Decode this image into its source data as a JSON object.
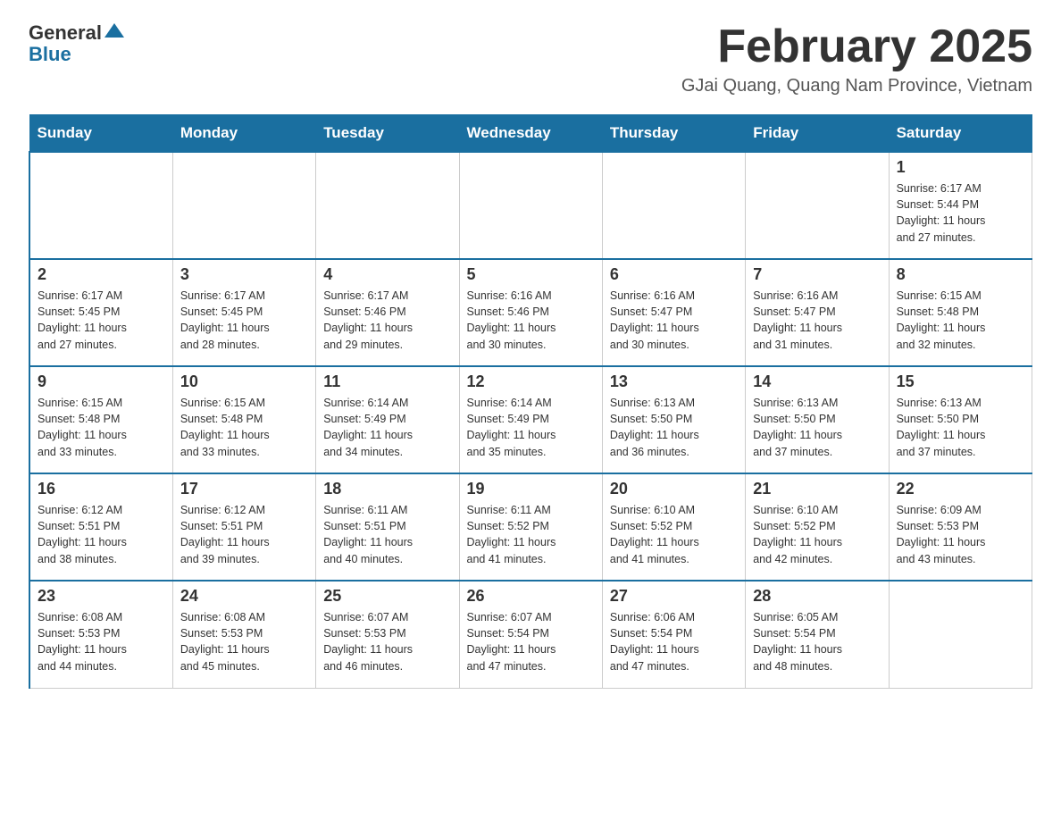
{
  "header": {
    "logo_general": "General",
    "logo_blue": "Blue",
    "title": "February 2025",
    "subtitle": "GJai Quang, Quang Nam Province, Vietnam"
  },
  "days_of_week": [
    "Sunday",
    "Monday",
    "Tuesday",
    "Wednesday",
    "Thursday",
    "Friday",
    "Saturday"
  ],
  "weeks": [
    [
      {
        "day": "",
        "info": ""
      },
      {
        "day": "",
        "info": ""
      },
      {
        "day": "",
        "info": ""
      },
      {
        "day": "",
        "info": ""
      },
      {
        "day": "",
        "info": ""
      },
      {
        "day": "",
        "info": ""
      },
      {
        "day": "1",
        "info": "Sunrise: 6:17 AM\nSunset: 5:44 PM\nDaylight: 11 hours\nand 27 minutes."
      }
    ],
    [
      {
        "day": "2",
        "info": "Sunrise: 6:17 AM\nSunset: 5:45 PM\nDaylight: 11 hours\nand 27 minutes."
      },
      {
        "day": "3",
        "info": "Sunrise: 6:17 AM\nSunset: 5:45 PM\nDaylight: 11 hours\nand 28 minutes."
      },
      {
        "day": "4",
        "info": "Sunrise: 6:17 AM\nSunset: 5:46 PM\nDaylight: 11 hours\nand 29 minutes."
      },
      {
        "day": "5",
        "info": "Sunrise: 6:16 AM\nSunset: 5:46 PM\nDaylight: 11 hours\nand 30 minutes."
      },
      {
        "day": "6",
        "info": "Sunrise: 6:16 AM\nSunset: 5:47 PM\nDaylight: 11 hours\nand 30 minutes."
      },
      {
        "day": "7",
        "info": "Sunrise: 6:16 AM\nSunset: 5:47 PM\nDaylight: 11 hours\nand 31 minutes."
      },
      {
        "day": "8",
        "info": "Sunrise: 6:15 AM\nSunset: 5:48 PM\nDaylight: 11 hours\nand 32 minutes."
      }
    ],
    [
      {
        "day": "9",
        "info": "Sunrise: 6:15 AM\nSunset: 5:48 PM\nDaylight: 11 hours\nand 33 minutes."
      },
      {
        "day": "10",
        "info": "Sunrise: 6:15 AM\nSunset: 5:48 PM\nDaylight: 11 hours\nand 33 minutes."
      },
      {
        "day": "11",
        "info": "Sunrise: 6:14 AM\nSunset: 5:49 PM\nDaylight: 11 hours\nand 34 minutes."
      },
      {
        "day": "12",
        "info": "Sunrise: 6:14 AM\nSunset: 5:49 PM\nDaylight: 11 hours\nand 35 minutes."
      },
      {
        "day": "13",
        "info": "Sunrise: 6:13 AM\nSunset: 5:50 PM\nDaylight: 11 hours\nand 36 minutes."
      },
      {
        "day": "14",
        "info": "Sunrise: 6:13 AM\nSunset: 5:50 PM\nDaylight: 11 hours\nand 37 minutes."
      },
      {
        "day": "15",
        "info": "Sunrise: 6:13 AM\nSunset: 5:50 PM\nDaylight: 11 hours\nand 37 minutes."
      }
    ],
    [
      {
        "day": "16",
        "info": "Sunrise: 6:12 AM\nSunset: 5:51 PM\nDaylight: 11 hours\nand 38 minutes."
      },
      {
        "day": "17",
        "info": "Sunrise: 6:12 AM\nSunset: 5:51 PM\nDaylight: 11 hours\nand 39 minutes."
      },
      {
        "day": "18",
        "info": "Sunrise: 6:11 AM\nSunset: 5:51 PM\nDaylight: 11 hours\nand 40 minutes."
      },
      {
        "day": "19",
        "info": "Sunrise: 6:11 AM\nSunset: 5:52 PM\nDaylight: 11 hours\nand 41 minutes."
      },
      {
        "day": "20",
        "info": "Sunrise: 6:10 AM\nSunset: 5:52 PM\nDaylight: 11 hours\nand 41 minutes."
      },
      {
        "day": "21",
        "info": "Sunrise: 6:10 AM\nSunset: 5:52 PM\nDaylight: 11 hours\nand 42 minutes."
      },
      {
        "day": "22",
        "info": "Sunrise: 6:09 AM\nSunset: 5:53 PM\nDaylight: 11 hours\nand 43 minutes."
      }
    ],
    [
      {
        "day": "23",
        "info": "Sunrise: 6:08 AM\nSunset: 5:53 PM\nDaylight: 11 hours\nand 44 minutes."
      },
      {
        "day": "24",
        "info": "Sunrise: 6:08 AM\nSunset: 5:53 PM\nDaylight: 11 hours\nand 45 minutes."
      },
      {
        "day": "25",
        "info": "Sunrise: 6:07 AM\nSunset: 5:53 PM\nDaylight: 11 hours\nand 46 minutes."
      },
      {
        "day": "26",
        "info": "Sunrise: 6:07 AM\nSunset: 5:54 PM\nDaylight: 11 hours\nand 47 minutes."
      },
      {
        "day": "27",
        "info": "Sunrise: 6:06 AM\nSunset: 5:54 PM\nDaylight: 11 hours\nand 47 minutes."
      },
      {
        "day": "28",
        "info": "Sunrise: 6:05 AM\nSunset: 5:54 PM\nDaylight: 11 hours\nand 48 minutes."
      },
      {
        "day": "",
        "info": ""
      }
    ]
  ]
}
